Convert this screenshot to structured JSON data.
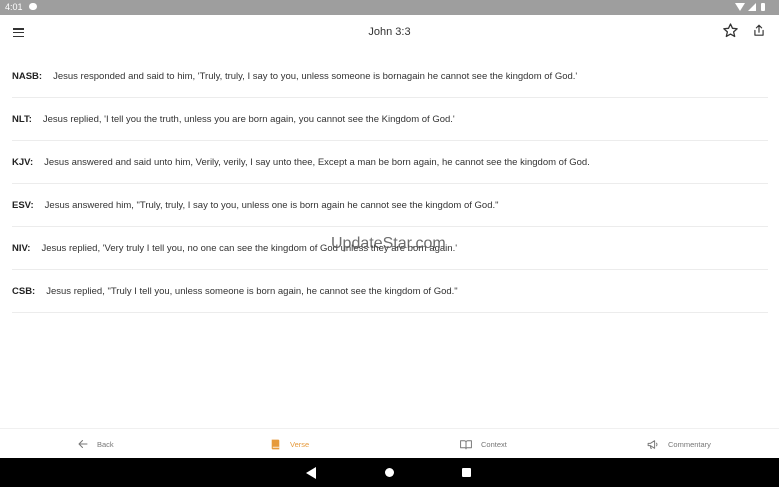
{
  "status_bar": {
    "time": "4:01"
  },
  "app_bar": {
    "title": "John 3:3",
    "icons": [
      "menu-icon",
      "star-icon",
      "share-icon"
    ]
  },
  "verses": [
    {
      "abbr": "NASB:",
      "text": "Jesus responded and said to him, 'Truly, truly, I say to you, unless someone is bornagain he cannot see the kingdom of God.'"
    },
    {
      "abbr": "NLT:",
      "text": "Jesus replied, 'I tell you the truth, unless you are born again, you cannot see the Kingdom of God.'"
    },
    {
      "abbr": "KJV:",
      "text": "Jesus answered and said unto him, Verily, verily, I say unto thee, Except a man be born again, he cannot see the kingdom of God."
    },
    {
      "abbr": "ESV:",
      "text": "Jesus answered him, \"Truly, truly, I say to you, unless one is born again he cannot see the kingdom of God.\""
    },
    {
      "abbr": "NIV:",
      "text": "Jesus replied, 'Very truly I tell you, no one can see the kingdom of God unless they are born again.'"
    },
    {
      "abbr": "CSB:",
      "text": "Jesus replied, \"Truly I tell you, unless someone is born again, he cannot see the kingdom of God.\""
    }
  ],
  "watermark": "UpdateStar.com",
  "bottom_nav": {
    "back": "Back",
    "verse": "Verse",
    "context": "Context",
    "commentary": "Commentary",
    "active": "verse",
    "active_color": "#e69a3c"
  }
}
